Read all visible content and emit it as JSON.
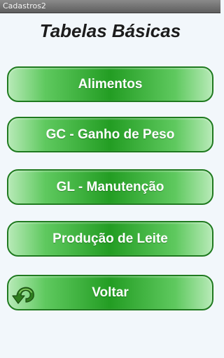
{
  "window": {
    "title": "Cadastros2"
  },
  "page": {
    "heading": "Tabelas Básicas"
  },
  "menu": {
    "buttons": [
      {
        "label": "Alimentos"
      },
      {
        "label": "GC - Ganho de Peso"
      },
      {
        "label": "GL - Manutenção"
      },
      {
        "label": "Produção de Leite"
      }
    ],
    "back": {
      "label": "Voltar",
      "icon": "back-arrow-icon"
    }
  },
  "colors": {
    "button_border": "#1f7a1f",
    "button_center": "#239d23",
    "button_edge": "#b7eab7",
    "background": "#f2f7fb"
  }
}
